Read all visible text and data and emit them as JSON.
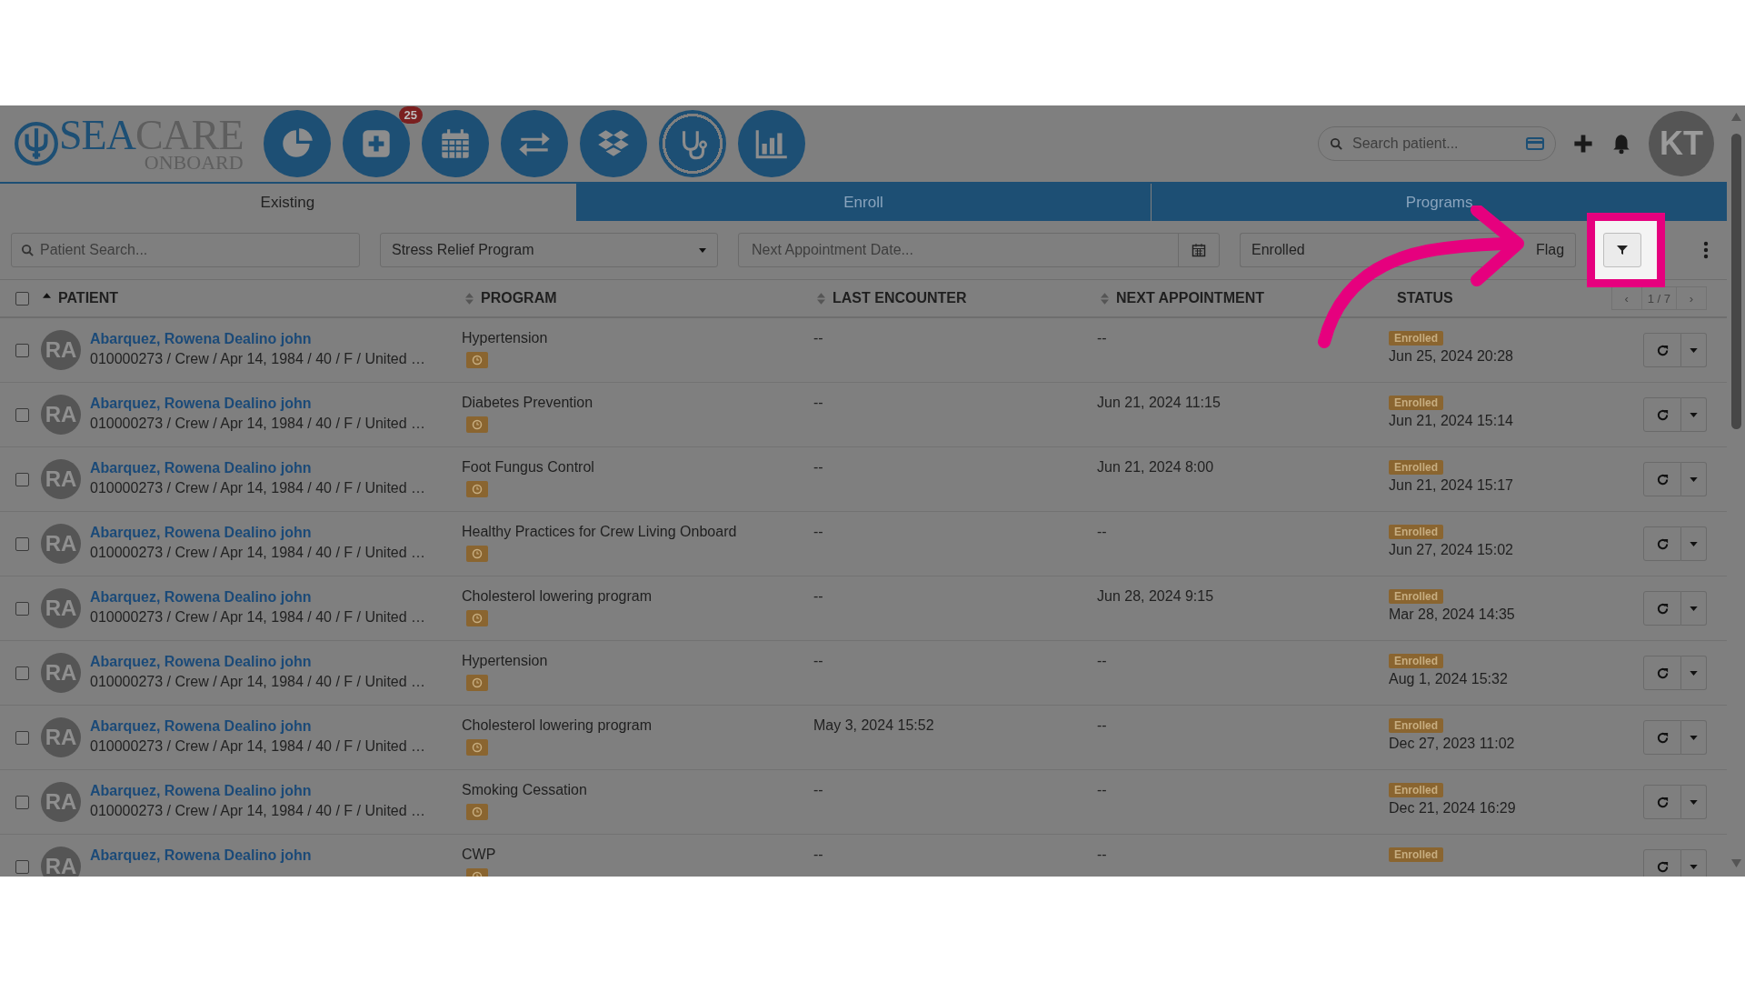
{
  "header": {
    "logo": {
      "part_a": "SEA",
      "part_b": "CARE",
      "sub": "ONBOARD"
    },
    "nav_icons": [
      {
        "kind": "pie",
        "selected": false
      },
      {
        "kind": "plus",
        "selected": false,
        "badge": "25"
      },
      {
        "kind": "calendar",
        "selected": false
      },
      {
        "kind": "arrows",
        "selected": false
      },
      {
        "kind": "boxes",
        "selected": false
      },
      {
        "kind": "stethoscope",
        "selected": true
      },
      {
        "kind": "chart",
        "selected": false
      }
    ],
    "search": {
      "placeholder": "Search patient..."
    },
    "user": {
      "initials": "KT"
    }
  },
  "tabs": [
    {
      "label": "Existing",
      "selected": true
    },
    {
      "label": "Enroll",
      "selected": false
    },
    {
      "label": "Programs",
      "selected": false
    }
  ],
  "filters": {
    "patient_search": {
      "placeholder": "Patient Search..."
    },
    "program": {
      "value": "Stress Relief Program"
    },
    "next_appointment": {
      "placeholder": "Next Appointment Date..."
    },
    "status": {
      "value": "Enrolled"
    },
    "flag": "Flag"
  },
  "table": {
    "select_all_checked": false,
    "columns": [
      {
        "label": "PATIENT",
        "sorted": true
      },
      {
        "label": "PROGRAM",
        "sorted": false
      },
      {
        "label": "LAST ENCOUNTER",
        "sorted": false
      },
      {
        "label": "NEXT APPOINTMENT",
        "sorted": false
      },
      {
        "label": "STATUS"
      }
    ],
    "pagination": {
      "prev": "‹",
      "page": "1 / 7",
      "next": "›"
    },
    "rows": [
      {
        "initials": "RA",
        "name": "Abarquez, Rowena Dealino john",
        "details": "010000273 / Crew / Apr 14, 1984 / 40 / F / United …",
        "program": "Hypertension",
        "last_encounter": "--",
        "next_appointment": "--",
        "status": "Enrolled",
        "status_date": "Jun 25, 2024 20:28",
        "checked": false
      },
      {
        "initials": "RA",
        "name": "Abarquez, Rowena Dealino john",
        "details": "010000273 / Crew / Apr 14, 1984 / 40 / F / United …",
        "program": "Diabetes Prevention",
        "last_encounter": "--",
        "next_appointment": "Jun 21, 2024 11:15",
        "status": "Enrolled",
        "status_date": "Jun 21, 2024 15:14",
        "checked": false
      },
      {
        "initials": "RA",
        "name": "Abarquez, Rowena Dealino john",
        "details": "010000273 / Crew / Apr 14, 1984 / 40 / F / United …",
        "program": "Foot Fungus Control",
        "last_encounter": "--",
        "next_appointment": "Jun 21, 2024 8:00",
        "status": "Enrolled",
        "status_date": "Jun 21, 2024 15:17",
        "checked": false
      },
      {
        "initials": "RA",
        "name": "Abarquez, Rowena Dealino john",
        "details": "010000273 / Crew / Apr 14, 1984 / 40 / F / United …",
        "program": "Healthy Practices for Crew Living Onboard",
        "last_encounter": "--",
        "next_appointment": "--",
        "status": "Enrolled",
        "status_date": "Jun 27, 2024 15:02",
        "checked": false
      },
      {
        "initials": "RA",
        "name": "Abarquez, Rowena Dealino john",
        "details": "010000273 / Crew / Apr 14, 1984 / 40 / F / United …",
        "program": "Cholesterol lowering program",
        "last_encounter": "--",
        "next_appointment": "Jun 28, 2024 9:15",
        "status": "Enrolled",
        "status_date": "Mar 28, 2024 14:35",
        "checked": false
      },
      {
        "initials": "RA",
        "name": "Abarquez, Rowena Dealino john",
        "details": "010000273 / Crew / Apr 14, 1984 / 40 / F / United …",
        "program": "Hypertension",
        "last_encounter": "--",
        "next_appointment": "--",
        "status": "Enrolled",
        "status_date": "Aug 1, 2024 15:32",
        "checked": false
      },
      {
        "initials": "RA",
        "name": "Abarquez, Rowena Dealino john",
        "details": "010000273 / Crew / Apr 14, 1984 / 40 / F / United …",
        "program": "Cholesterol lowering program",
        "last_encounter": "May 3, 2024 15:52",
        "next_appointment": "--",
        "status": "Enrolled",
        "status_date": "Dec 27, 2023 11:02",
        "checked": false
      },
      {
        "initials": "RA",
        "name": "Abarquez, Rowena Dealino john",
        "details": "010000273 / Crew / Apr 14, 1984 / 40 / F / United …",
        "program": "Smoking Cessation",
        "last_encounter": "--",
        "next_appointment": "--",
        "status": "Enrolled",
        "status_date": "Dec 21, 2024 16:29",
        "checked": false
      },
      {
        "initials": "RA",
        "name": "Abarquez, Rowena Dealino john",
        "program": "CWP",
        "last_encounter": "--",
        "next_appointment": "--",
        "status": "Enrolled",
        "checked": false
      }
    ]
  }
}
